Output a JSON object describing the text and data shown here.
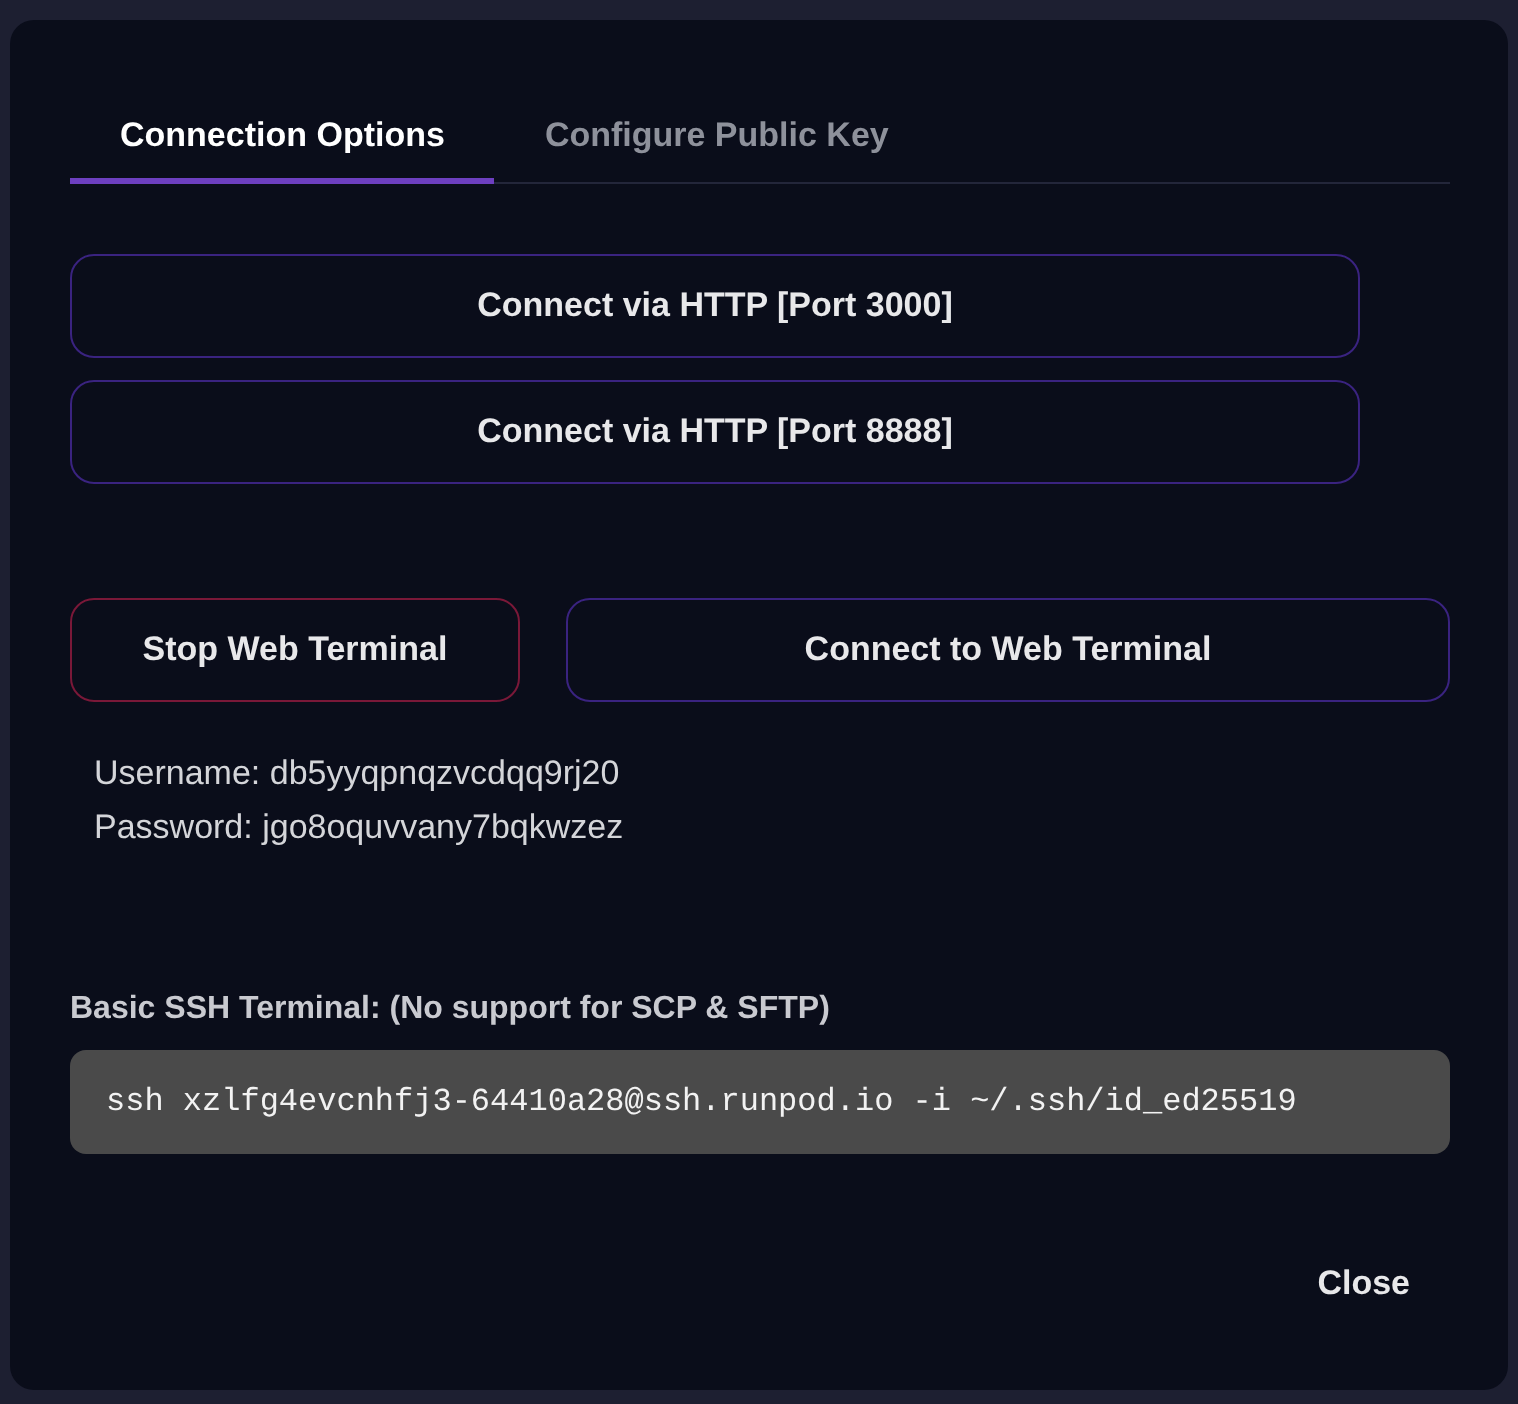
{
  "tabs": [
    {
      "label": "Connection Options",
      "selected": true
    },
    {
      "label": "Configure Public Key",
      "selected": false
    }
  ],
  "http_buttons": [
    {
      "label": "Connect via HTTP [Port 3000]"
    },
    {
      "label": "Connect via HTTP [Port 8888]"
    }
  ],
  "web_terminal": {
    "buttons": [
      {
        "label": "Stop Web Terminal",
        "kind": "danger"
      },
      {
        "label": "Connect to Web Terminal",
        "kind": "primary"
      }
    ],
    "credentials": [
      "Username: db5yyqpnqzvcdqq9rj20",
      "Password: jgo8oquvvany7bqkwzez"
    ]
  },
  "ssh": {
    "label": "Basic SSH Terminal: (No support for SCP & SFTP)",
    "command": "ssh xzlfg4evcnhfj3-64410a28@ssh.runpod.io -i ~/.ssh/id_ed25519"
  },
  "footer": {
    "close_button": "Close"
  }
}
